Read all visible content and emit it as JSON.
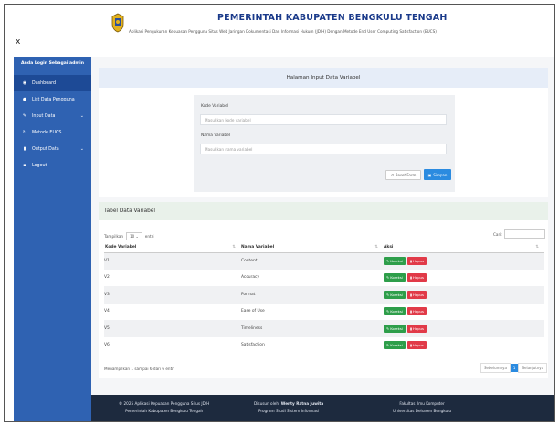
{
  "header": {
    "close": "x",
    "title": "PEMERINTAH KABUPATEN BENGKULU TENGAH",
    "subtitle": "Aplikasi Pengukuran Kepuasan Pengguna Situs Web Jaringan Dokumentasi Dan Informasi Hukum (JDIH) Dengan Metode End User Computing Satisfaction (EUCS)"
  },
  "sidebar": {
    "heading": "Anda Login Sebagai admin",
    "items": [
      {
        "label": "Dashboard",
        "icon": "dashboard-icon",
        "glyph": "◉"
      },
      {
        "label": "List Data Pengguna",
        "icon": "user-icon",
        "glyph": "●"
      },
      {
        "label": "Input Data",
        "icon": "edit-icon",
        "glyph": "✎"
      },
      {
        "label": "Metode EUCS",
        "icon": "refresh-icon",
        "glyph": "↻"
      },
      {
        "label": "Output Data",
        "icon": "file-icon",
        "glyph": "▮"
      },
      {
        "label": "Logout",
        "icon": "logout-icon",
        "glyph": "▪"
      }
    ]
  },
  "form": {
    "title": "Halaman Input Data Variabel",
    "kode_label": "Kode Variabel",
    "kode_placeholder": "Masukkan kode variabel",
    "nama_label": "Nama Variabel",
    "nama_placeholder": "Masukkan nama variabel",
    "reset_label": "Reset Form",
    "save_label": "Simpan"
  },
  "table": {
    "title": "Tabel Data Variabel",
    "show_label": "Tampilkan",
    "show_value": "10",
    "entries_label": "entri",
    "search_label": "Cari:",
    "columns": [
      "Kode Variabel",
      "Nama Variabel",
      "Aksi"
    ],
    "rows": [
      {
        "kode": "V1",
        "nama": "Content"
      },
      {
        "kode": "V2",
        "nama": "Accuracy"
      },
      {
        "kode": "V3",
        "nama": "Format"
      },
      {
        "kode": "V4",
        "nama": "Ease of Use"
      },
      {
        "kode": "V5",
        "nama": "Timeliness"
      },
      {
        "kode": "V6",
        "nama": "Satisfaction"
      }
    ],
    "edit_label": "Koreksi",
    "delete_label": "Hapus",
    "info": "Menampilkan 1 sampai 6 dari 6 entri",
    "prev": "Sebelumnya",
    "page": "1",
    "next": "Selanjutnya"
  },
  "footer": {
    "col1_line1": "© 2025 Aplikasi Kepuasan Pengguna Situs JDIH",
    "col1_line2": "Pemerintah Kabupaten Bengkulu Tengah",
    "col2_line1_prefix": "Disusun oleh: ",
    "col2_line1_name": "Wenty Ratna Juwita",
    "col2_line2": "Program Studi Sistem Informasi",
    "col3_line1": "Fakultas Ilmu Komputer",
    "col3_line2": "Universitas Dehasen Bengkulu"
  },
  "colors": {
    "sidebar": "#2f62b2",
    "primary": "#2b8be0",
    "edit": "#2e9e4a",
    "delete": "#e13a48",
    "footer": "#1d2a3e"
  }
}
